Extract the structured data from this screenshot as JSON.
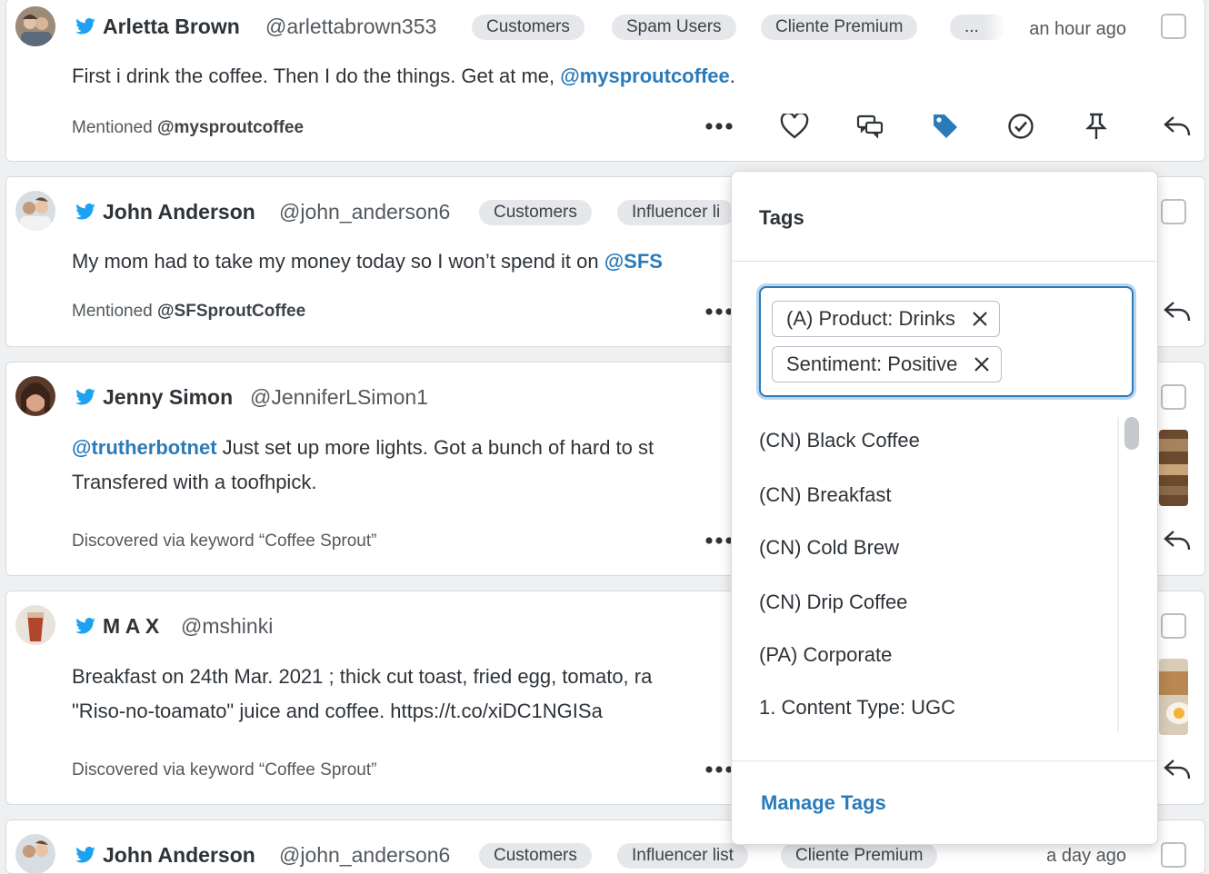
{
  "posts": [
    {
      "name": "Arletta Brown",
      "handle": "@arlettabrown353",
      "tags": [
        "Customers",
        "Spam Users",
        "Cliente Premium",
        "..."
      ],
      "time": "an hour ago",
      "body_lines": [
        [
          "First i drink the coffee. Then I do the things. Get at me, ",
          "@mysproutcoffee",
          "."
        ]
      ],
      "footer_prefix": "Mentioned ",
      "footer_bold": "@mysproutcoffee"
    },
    {
      "name": "John Anderson",
      "handle": "@john_anderson6",
      "tags": [
        "Customers",
        "Influencer li"
      ],
      "time": "",
      "body_text": "My mom had to take my money today so I won’t spend it on ",
      "body_mention": "@SFS",
      "footer_prefix": "Mentioned ",
      "footer_bold": "@SFSproutCoffee"
    },
    {
      "name": "Jenny Simon",
      "handle": "@JenniferLSimon1",
      "body_mention": "@trutherbotnet",
      "body_text": " Just set up more lights. Got a bunch of hard to st",
      "body_line2": "Transfered with a toofhpick.",
      "footer_prefix": "Discovered via keyword “Coffee Sprout”"
    },
    {
      "name": "M A X",
      "handle": "@mshinki",
      "body_text": "Breakfast on 24th Mar. 2021 ; thick cut toast, fried egg, tomato, ra",
      "body_line2": "\"Riso-no-toamato\" juice and coffee. https://t.co/xiDC1NGISa",
      "footer_prefix": "Discovered via keyword “Coffee Sprout”"
    },
    {
      "name": "John Anderson",
      "handle": "@john_anderson6",
      "tags": [
        "Customers",
        "Influencer list",
        "Cliente Premium"
      ],
      "time": "a day ago"
    }
  ],
  "tag_dropdown": {
    "title": "Tags",
    "selected": [
      "(A) Product: Drinks",
      "Sentiment: Positive"
    ],
    "options": [
      "(CN) Black Coffee",
      "(CN) Breakfast",
      "(CN) Cold Brew",
      "(CN) Drip Coffee",
      "(PA) Corporate",
      "1. Content Type: UGC"
    ],
    "manage_label": "Manage Tags"
  },
  "colors": {
    "accent": "#2b7bb9",
    "twitter": "#1da1f2",
    "tag_bg": "#e5e7ea"
  }
}
